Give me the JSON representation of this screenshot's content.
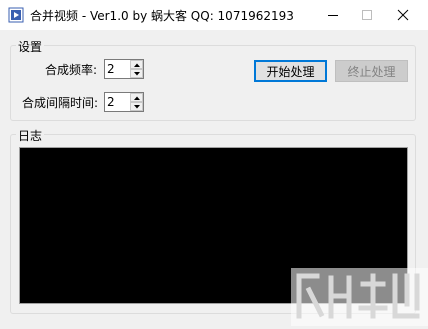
{
  "window": {
    "title": "合并视频 - Ver1.0 by 蜗大客 QQ:  1071962193"
  },
  "settings": {
    "legend": "设置",
    "frequency_label": "合成频率:",
    "frequency_value": "2",
    "interval_label": "合成间隔时间:",
    "interval_value": "2",
    "start_button": "开始处理",
    "stop_button": "终止处理"
  },
  "log": {
    "legend": "日志",
    "content": ""
  },
  "colors": {
    "focus_border": "#0078d7",
    "log_background": "#000000"
  },
  "icons": [
    "app-icon",
    "minimize-icon",
    "maximize-icon",
    "close-icon",
    "spin-up-icon",
    "spin-down-icon",
    "watermark-logo"
  ]
}
